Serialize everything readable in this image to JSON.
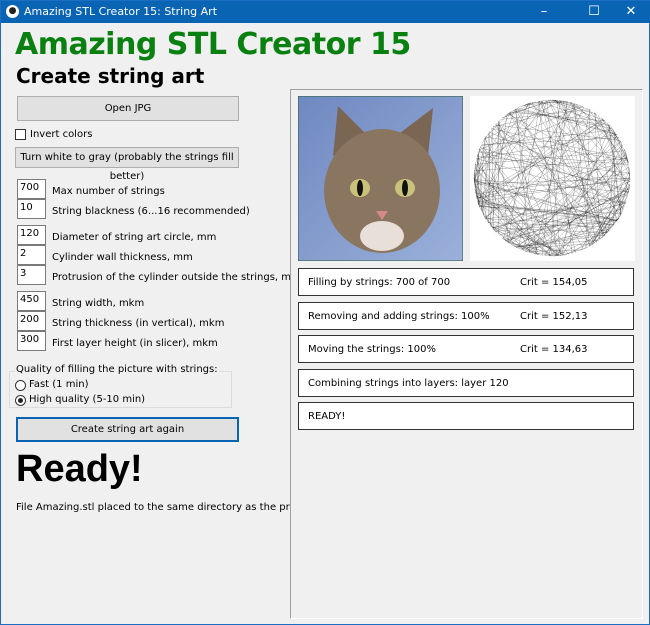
{
  "window": {
    "title": "Amazing STL Creator 15: String Art",
    "icon": "paw-icon",
    "minimize": "–",
    "maximize": "☐",
    "close": "✕"
  },
  "header": {
    "title": "Amazing STL Creator 15",
    "subtitle": "Create string art",
    "title_color": "#0a8010"
  },
  "controls": {
    "open_jpg": "Open JPG",
    "invert_colors": {
      "label": "Invert colors",
      "checked": false
    },
    "white_to_gray": "Turn white to gray (probably the strings fill better)",
    "params": [
      {
        "value": "700",
        "label": "Max number of strings"
      },
      {
        "value": "10",
        "label": "String blackness (6...16 recommended)"
      },
      {
        "value": "120",
        "label": "Diameter of string art circle, mm"
      },
      {
        "value": "2",
        "label": "Cylinder wall thickness, mm"
      },
      {
        "value": "3",
        "label": "Protrusion of the cylinder outside the strings, mm"
      },
      {
        "value": "450",
        "label": "String width, mkm"
      },
      {
        "value": "200",
        "label": "String thickness (in vertical), mkm"
      },
      {
        "value": "300",
        "label": "First layer height (in slicer), mkm"
      }
    ],
    "quality": {
      "legend": "Quality of filling the picture with strings:",
      "options": [
        "Fast (1 min)",
        "High quality (5-10 min)"
      ],
      "selected": "High quality (5-10 min)"
    },
    "create_again": "Create string art again",
    "ready_big": "Ready!",
    "file_note": "File Amazing.stl placed to the same directory as the program"
  },
  "status": [
    {
      "text": "Filling by strings: 700 of 700",
      "crit": "Crit = 154,05"
    },
    {
      "text": "Removing and adding strings: 100%",
      "crit": "Crit = 152,13"
    },
    {
      "text": "Moving the strings: 100%",
      "crit": "Crit = 134,63"
    },
    {
      "text": "Combining strings into layers: layer 120",
      "crit": ""
    },
    {
      "text": "READY!",
      "crit": ""
    }
  ]
}
